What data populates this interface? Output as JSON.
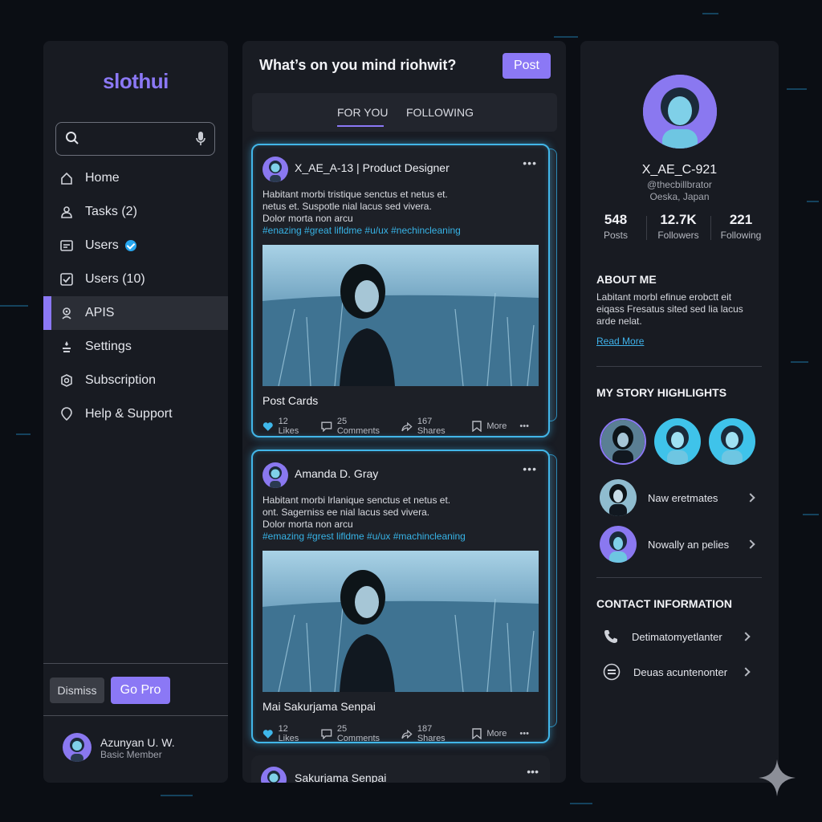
{
  "app": {
    "logo": "slothui"
  },
  "search": {
    "placeholder": ""
  },
  "sidebar": {
    "items": [
      {
        "label": "Home",
        "icon": "home-icon"
      },
      {
        "label": "Tasks (2)",
        "icon": "tasks-icon"
      },
      {
        "label": "Users",
        "icon": "users-icon",
        "verified": true
      },
      {
        "label": "Users (10)",
        "icon": "users-check-icon"
      },
      {
        "label": "APIS",
        "icon": "api-icon",
        "active": true
      },
      {
        "label": "Settings",
        "icon": "settings-icon"
      },
      {
        "label": "Subscription",
        "icon": "subscription-icon"
      },
      {
        "label": "Help & Support",
        "icon": "help-icon"
      }
    ],
    "dismiss_label": "Dismiss",
    "gopro_label": "Go Pro",
    "user": {
      "name": "Azunyan U. W.",
      "role": "Basic Member"
    }
  },
  "feed": {
    "compose_prompt": "What’s on you mind riohwit?",
    "post_label": "Post",
    "tabs": [
      {
        "label": "FOR YOU",
        "active": true
      },
      {
        "label": "FOLLOWING",
        "active": false
      }
    ],
    "posts": [
      {
        "author": "X_AE_A-13 | Product Designer",
        "text_lines": [
          "Habitant morbi tristique senctus et netus et.",
          "netus et. Suspotle nial lacus sed vivera.",
          "Dolor morta non arcu"
        ],
        "tags": "#enazing #great lifldme #u/ux #nechincleaning",
        "title": "Post Cards",
        "likes": "12 Likes",
        "comments": "25 Comments",
        "shares": "167 Shares",
        "more": "More"
      },
      {
        "author": "Amanda D. Gray",
        "text_lines": [
          "Habitant morbi lrlanique senctus et netus et.",
          "ont. Sagerniss ee nial lacus sed vivera.",
          "Dolor morta non arcu"
        ],
        "tags": "#emazing #grest lifldme #u/ux #machincleaning",
        "title": "Mai Sakurjama Senpai",
        "likes": "12 Likes",
        "comments": "25 Comments",
        "shares": "187 Shares",
        "more": "More"
      },
      {
        "author": "Sakurjama Senpai"
      }
    ]
  },
  "profile": {
    "name": "X_AE_C-921",
    "handle": "@thecbillbrator",
    "location": "Oeska, Japan",
    "stats": [
      {
        "value": "548",
        "label": "Posts"
      },
      {
        "value": "12.7K",
        "label": "Followers"
      },
      {
        "value": "221",
        "label": "Following"
      }
    ],
    "about_heading": "ABOUT ME",
    "about_lines": [
      "Labitant morbl efinue erobctt eit",
      "eiqass Fresatus sited sed lia lacus",
      "arde nelat."
    ],
    "read_more": "Read More",
    "highlights_heading": "MY STORY HIGHLIGHTS",
    "highlight_rows": [
      {
        "label": "Naw eretmates"
      },
      {
        "label": "Nowally an pelies"
      }
    ],
    "contact_heading": "CONTACT INFORMATION",
    "contacts": [
      {
        "label": "Detimatomyetlanter",
        "icon": "phone-icon"
      },
      {
        "label": "Deuas acuntenonter",
        "icon": "email-icon"
      }
    ]
  },
  "colors": {
    "accent": "#8b78f5",
    "glow": "#42b6e8",
    "panel": "#181b22",
    "background": "#0b0e14",
    "tag": "#37b3e6"
  }
}
